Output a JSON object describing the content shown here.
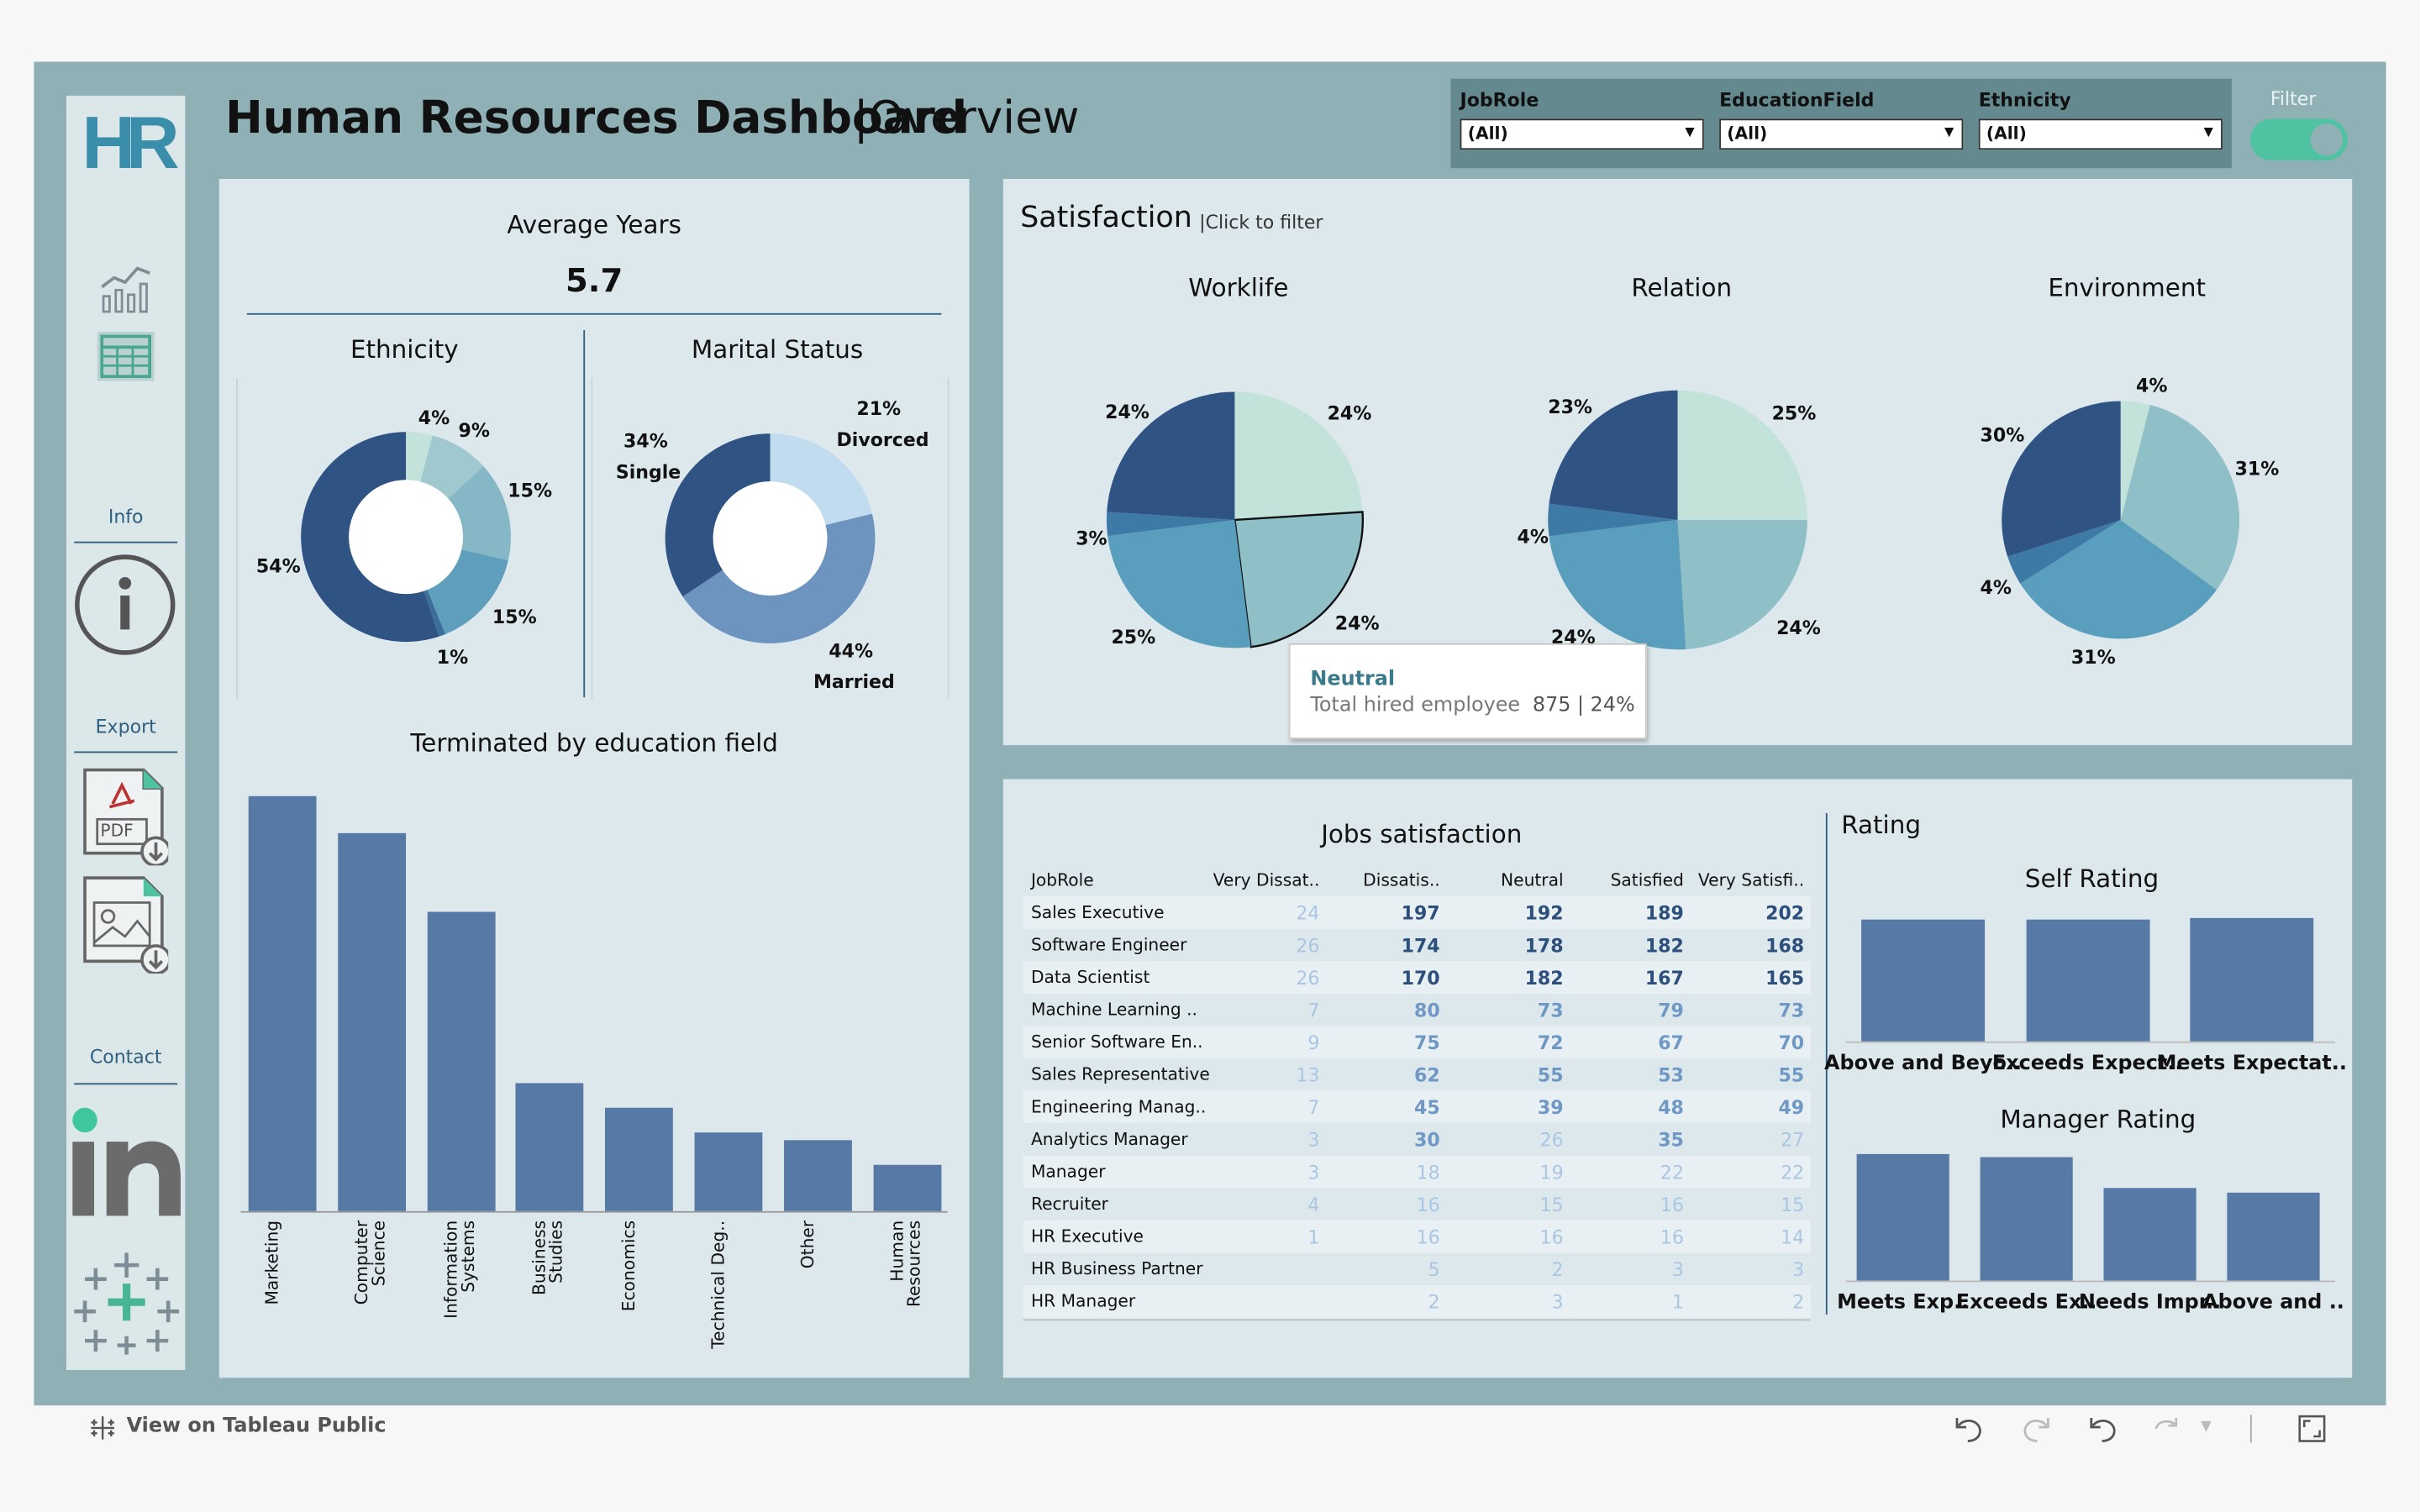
{
  "header": {
    "title": "Human Resources Dashboard",
    "subtitle": "|Overview",
    "logo": "HR"
  },
  "filters": [
    {
      "label": "JobRole",
      "value": "(All)"
    },
    {
      "label": "EducationField",
      "value": "(All)"
    },
    {
      "label": "Ethnicity",
      "value": "(All)"
    }
  ],
  "filter_toggle": {
    "label": "Filter",
    "state": "on"
  },
  "sidebar": {
    "info": "Info",
    "export": "Export",
    "contact": "Contact",
    "pdf_label": "PDF",
    "icons": [
      "chart-icon",
      "table-icon",
      "info-icon",
      "pdf-download-icon",
      "image-download-icon",
      "linkedin-icon",
      "tableau-icon"
    ]
  },
  "avg_years": {
    "label": "Average Years",
    "value": "5.7"
  },
  "ethnicity": {
    "title": "Ethnicity",
    "labels": [
      "4%",
      "9%",
      "15%",
      "15%",
      "1%",
      "54%"
    ]
  },
  "marital": {
    "title": "Marital Status",
    "labels": {
      "single_pct": "34%",
      "single": "Single",
      "divorced_pct": "21%",
      "divorced": "Divorced",
      "married_pct": "44%",
      "married": "Married"
    }
  },
  "terminated": {
    "title": "Terminated by education field"
  },
  "satisfaction": {
    "title": "Satisfaction",
    "hint": "|Click to filter",
    "worklife": {
      "title": "Worklife",
      "labels": [
        "24%",
        "24%",
        "3%",
        "25%",
        "24%"
      ]
    },
    "relation": {
      "title": "Relation",
      "labels": [
        "23%",
        "25%",
        "4%",
        "24%",
        "24%"
      ]
    },
    "environment": {
      "title": "Environment",
      "labels": [
        "4%",
        "30%",
        "31%",
        "4%",
        "31%"
      ]
    }
  },
  "tooltip": {
    "title": "Neutral",
    "text": "Total hired employee",
    "value": "875 | 24%"
  },
  "jobs": {
    "title": "Jobs satisfaction",
    "columns": [
      "JobRole",
      "Very Dissat..",
      "Dissatis..",
      "Neutral",
      "Satisfied",
      "Very Satisfi.."
    ],
    "rows": [
      [
        "Sales Executive",
        "24",
        "197",
        "192",
        "189",
        "202"
      ],
      [
        "Software Engineer",
        "26",
        "174",
        "178",
        "182",
        "168"
      ],
      [
        "Data Scientist",
        "26",
        "170",
        "182",
        "167",
        "165"
      ],
      [
        "Machine Learning ..",
        "7",
        "80",
        "73",
        "79",
        "73"
      ],
      [
        "Senior Software En..",
        "9",
        "75",
        "72",
        "67",
        "70"
      ],
      [
        "Sales Representative",
        "13",
        "62",
        "55",
        "53",
        "55"
      ],
      [
        "Engineering Manag..",
        "7",
        "45",
        "39",
        "48",
        "49"
      ],
      [
        "Analytics Manager",
        "3",
        "30",
        "26",
        "35",
        "27"
      ],
      [
        "Manager",
        "3",
        "18",
        "19",
        "22",
        "22"
      ],
      [
        "Recruiter",
        "4",
        "16",
        "15",
        "16",
        "15"
      ],
      [
        "HR Executive",
        "1",
        "16",
        "16",
        "16",
        "14"
      ],
      [
        "HR Business Partner",
        "",
        "5",
        "2",
        "3",
        "3"
      ],
      [
        "HR Manager",
        "",
        "2",
        "3",
        "1",
        "2"
      ]
    ]
  },
  "rating": {
    "title": "Rating",
    "self_title": "Self Rating",
    "manager_title": "Manager Rating",
    "self_labels": [
      "Above and Beyo..",
      "Exceeds Expect..",
      "Meets Expectat.."
    ],
    "manager_labels": [
      "Meets Exp..",
      "Exceeds Ex..",
      "Needs Impr..",
      "Above and .."
    ]
  },
  "footer": {
    "tableau": "View on Tableau Public"
  },
  "chart_data": [
    {
      "type": "pie",
      "title": "Ethnicity",
      "values": [
        4,
        9,
        15,
        15,
        1,
        54
      ],
      "colors": [
        "#c3e3da",
        "#9fc8cf",
        "#85b7c6",
        "#5f9fbb",
        "#3c6e9a",
        "#2f5383"
      ]
    },
    {
      "type": "pie",
      "title": "Marital Status",
      "categories": [
        "Divorced",
        "Married",
        "Single"
      ],
      "values": [
        21,
        44,
        34
      ],
      "colors": [
        "#c1dcef",
        "#6c94bf",
        "#2f5383"
      ]
    },
    {
      "type": "bar",
      "title": "Terminated by education field",
      "categories": [
        "Marketing",
        "Computer Science",
        "Information Systems",
        "Business Studies",
        "Economics",
        "Technical Deg..",
        "Other",
        "Human Resources"
      ],
      "values": [
        100,
        91,
        72,
        31,
        25,
        19,
        17,
        11
      ]
    },
    {
      "type": "pie",
      "title": "Worklife",
      "values": [
        24,
        24,
        25,
        3,
        24
      ],
      "colors": [
        "#c3e3da",
        "#8fc0c8",
        "#5a9ebd",
        "#3d7aa5",
        "#2f5383"
      ]
    },
    {
      "type": "pie",
      "title": "Relation",
      "values": [
        25,
        24,
        24,
        4,
        23
      ],
      "colors": [
        "#c3e3da",
        "#8fc0c8",
        "#5a9ebd",
        "#3d7aa5",
        "#2f5383"
      ]
    },
    {
      "type": "pie",
      "title": "Environment",
      "values": [
        4,
        31,
        31,
        4,
        30
      ],
      "colors": [
        "#c3e3da",
        "#8fc0c8",
        "#5a9ebd",
        "#3d7aa5",
        "#2f5383"
      ]
    },
    {
      "type": "bar",
      "title": "Self Rating",
      "categories": [
        "Above and Beyo..",
        "Exceeds Expect..",
        "Meets Expectat.."
      ],
      "values": [
        100,
        100,
        101
      ]
    },
    {
      "type": "bar",
      "title": "Manager Rating",
      "categories": [
        "Meets Exp..",
        "Exceeds Ex..",
        "Needs Impr..",
        "Above and .."
      ],
      "values": [
        100,
        98,
        73,
        70
      ]
    }
  ]
}
